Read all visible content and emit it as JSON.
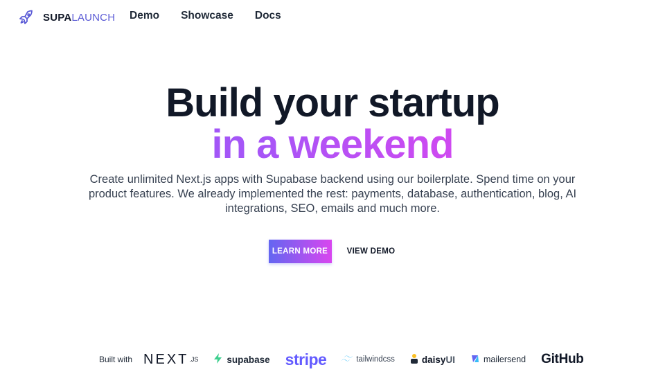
{
  "nav": {
    "brand": {
      "first": "SUPA",
      "second": "LAUNCH"
    },
    "links": [
      "Demo",
      "Showcase",
      "Docs"
    ]
  },
  "hero": {
    "title_line1": "Build your startup",
    "title_line2": "in a weekend",
    "subtitle": "Create unlimited Next.js apps with Supabase backend using our boilerplate. Spend time on your product features. We already implemented the rest: payments, database, authentication, blog, AI integrations, SEO, emails and much more.",
    "primary_cta": "LEARN MORE",
    "secondary_cta": "VIEW DEMO"
  },
  "built_with": {
    "label": "Built with",
    "logos": {
      "next": "NEXT",
      "next_suffix": ".JS",
      "supabase": "supabase",
      "stripe": "stripe",
      "tailwind": "tailwindcss",
      "daisy_prefix": "daisy",
      "daisy_suffix": "UI",
      "mailersend": "mailersend",
      "github": "GitHub"
    }
  },
  "colors": {
    "brand_accent": "#5b5bd6",
    "gradient_start": "#6366f1",
    "gradient_end": "#d946ef",
    "stripe": "#635bff",
    "supabase": "#3ecf8e",
    "tailwind": "#38bdf8"
  },
  "icons": {
    "brand": "rocket-icon",
    "supabase": "supabase-bolt-icon",
    "tailwind": "tailwind-wave-icon",
    "daisy": "daisyui-icon",
    "mailersend": "mailersend-icon"
  }
}
